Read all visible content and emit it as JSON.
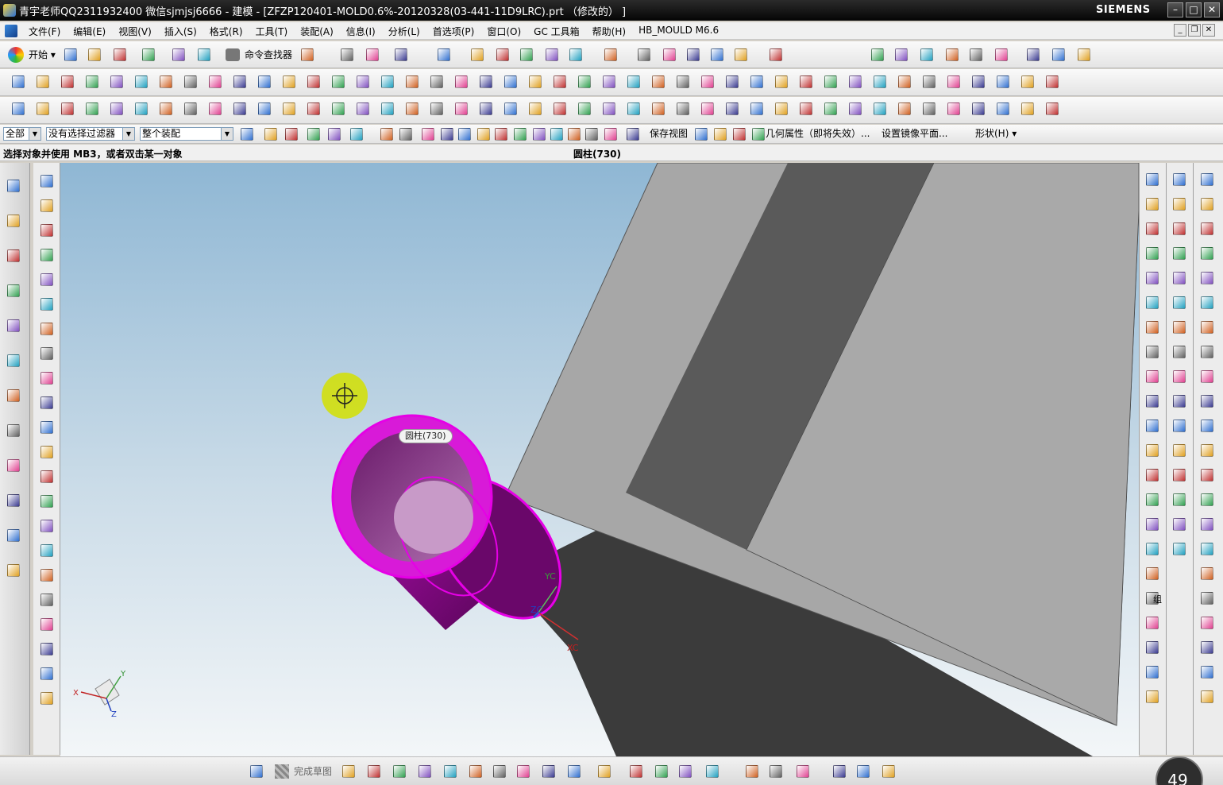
{
  "window": {
    "title": "青宇老师QQ2311932400 微信sjmjsj6666 - 建模 - [ZFZP120401-MOLD0.6%-20120328(03-441-11D9LRC).prt （修改的） ]",
    "brand": "SIEMENS",
    "controls": {
      "minimize": "–",
      "maximize": "□",
      "close": "✕"
    }
  },
  "menu": {
    "items": [
      "文件(F)",
      "编辑(E)",
      "视图(V)",
      "插入(S)",
      "格式(R)",
      "工具(T)",
      "装配(A)",
      "信息(I)",
      "分析(L)",
      "首选项(P)",
      "窗口(O)",
      "GC 工具箱",
      "帮助(H)",
      "HB_MOULD M6.6"
    ],
    "doc_controls": {
      "minimize": "_",
      "restore": "❐",
      "close": "✕"
    }
  },
  "toolbar": {
    "start_label": "开始",
    "command_finder_label": "命令查找器"
  },
  "selection_bar": {
    "type_filter": "全部",
    "selection_filter": "没有选择过滤器",
    "scope": "整个装配",
    "save_view": "保存视图",
    "geometry_props": "几何属性（即将失效）...",
    "mirror_plane": "设置镜像平面...",
    "shape_menu": "形状(H)"
  },
  "cue_line": {
    "prompt": "选择对象并使用 MB3，或者双击某一对象",
    "status": "圆柱(730)"
  },
  "viewport": {
    "tooltip": "圆柱(730)",
    "axis_labels": {
      "yc": "YC",
      "xc": "XC",
      "zc": "ZC"
    },
    "triad_labels": {
      "x": "X",
      "y": "Y",
      "z": "Z"
    },
    "highlight_color": "#e600e6"
  },
  "bottom_toolbar": {
    "finish_sketch": "完成草图"
  },
  "right_panel": {
    "group_label": "组"
  },
  "overlay": {
    "clock_number": "49"
  }
}
